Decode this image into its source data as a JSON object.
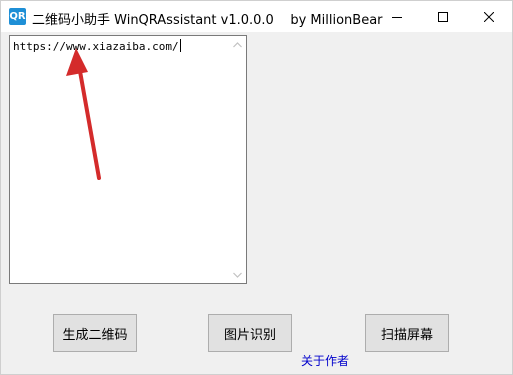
{
  "window": {
    "icon_text": "QR",
    "title": "二维码小助手 WinQRAssistant v1.0.0.0    by MillionBear",
    "controls": {
      "minimize": "minimize-icon",
      "maximize": "maximize-icon",
      "close": "close-icon"
    }
  },
  "input": {
    "value": "https://www.xiazaiba.com/"
  },
  "buttons": {
    "generate": "生成二维码",
    "recognize_image": "图片识别",
    "scan_screen": "扫描屏幕"
  },
  "about_link": "关于作者",
  "colors": {
    "annotation_arrow": "#d42b2b",
    "link": "#0000cc",
    "app_icon": "#1e8fd6"
  }
}
